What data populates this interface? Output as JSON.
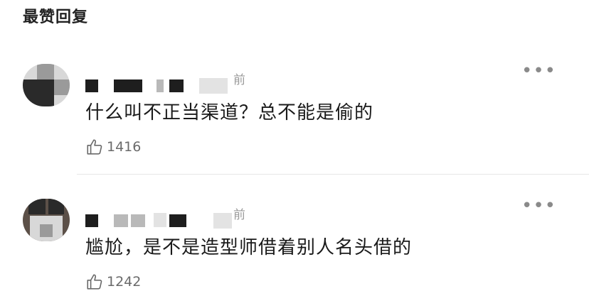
{
  "section": {
    "title": "最赞回复"
  },
  "comments": [
    {
      "time_suffix": "前",
      "more_icon": "more-horizontal-icon",
      "text": "什么叫不正当渠道？总不能是偷的",
      "like_icon": "thumbs-up-icon",
      "likes": "1416"
    },
    {
      "time_suffix": "前",
      "more_icon": "more-horizontal-icon",
      "text": "尴尬，是不是造型师借着别人名头借的",
      "like_icon": "thumbs-up-icon",
      "likes": "1242"
    }
  ],
  "colors": {
    "text": "#1a1a1a",
    "muted": "#9a9a9a",
    "divider": "#e6e6e6"
  }
}
